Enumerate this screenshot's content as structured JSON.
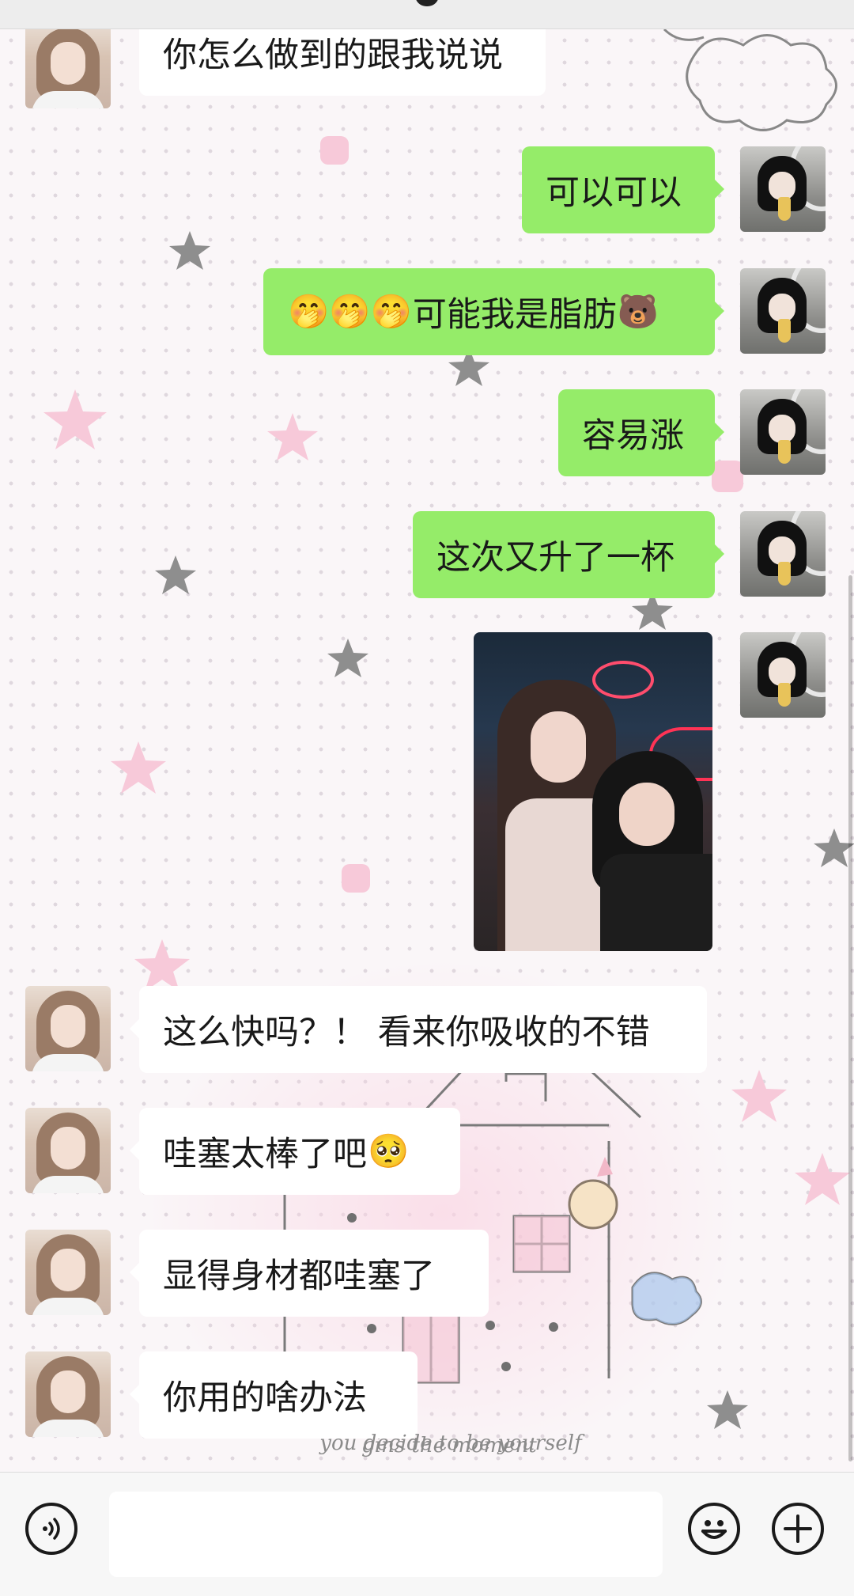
{
  "header": {
    "title": ""
  },
  "wallpaper": {
    "text_line1": "gins the moment",
    "text_line2": "you decide to be yourself"
  },
  "messages": [
    {
      "sender": "other",
      "text": "你怎么做到的跟我说说"
    },
    {
      "sender": "self",
      "text": "可以可以"
    },
    {
      "sender": "self",
      "emoji_prefix": "🤭🤭🤭",
      "text": "可能我是脂肪",
      "emoji_suffix": "🐻"
    },
    {
      "sender": "self",
      "text": "容易涨"
    },
    {
      "sender": "self",
      "text": "这次又升了一杯"
    },
    {
      "sender": "self",
      "type": "image"
    },
    {
      "sender": "other",
      "text": "这么快吗？！ 看来你吸收的不错"
    },
    {
      "sender": "other",
      "text": "哇塞太棒了吧",
      "emoji_suffix": "🥺"
    },
    {
      "sender": "other",
      "text": "显得身材都哇塞了"
    },
    {
      "sender": "other",
      "text": "你用的啥办法"
    }
  ],
  "input_bar": {
    "value": "",
    "voice_icon": "voice-icon",
    "emoji_icon": "emoji-icon",
    "plus_icon": "plus-icon"
  },
  "colors": {
    "self_bubble": "#95ec69",
    "other_bubble": "#ffffff",
    "background": "#faf6f8"
  }
}
